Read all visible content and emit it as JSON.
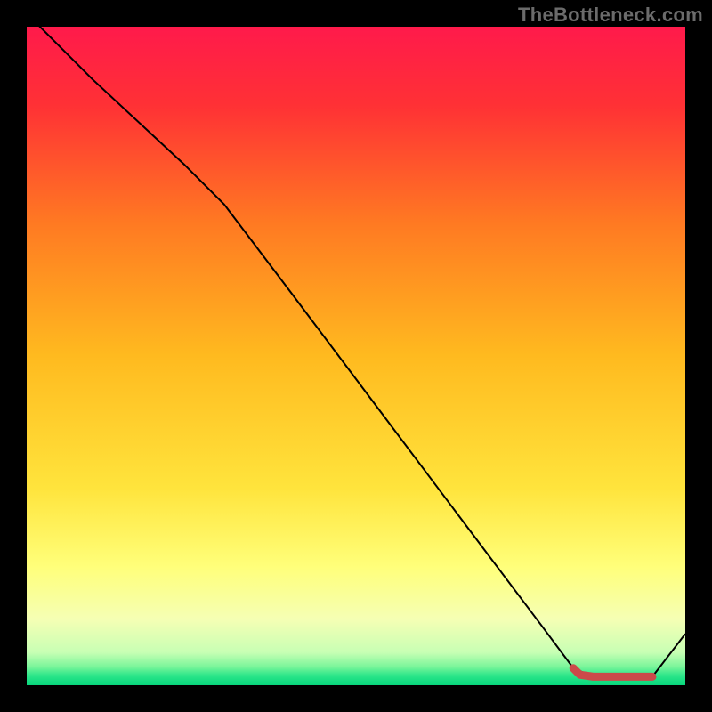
{
  "attribution": "TheBottleneck.com",
  "chart_data": {
    "type": "line",
    "title": "",
    "xlabel": "",
    "ylabel": "",
    "xlim": [
      0,
      100
    ],
    "ylim": [
      0,
      100
    ],
    "background_gradient": {
      "stops": [
        {
          "offset": 0.0,
          "color": "#ff1a4b"
        },
        {
          "offset": 0.12,
          "color": "#ff3135"
        },
        {
          "offset": 0.3,
          "color": "#ff7a22"
        },
        {
          "offset": 0.5,
          "color": "#ffba1f"
        },
        {
          "offset": 0.7,
          "color": "#ffe43c"
        },
        {
          "offset": 0.82,
          "color": "#ffff7a"
        },
        {
          "offset": 0.9,
          "color": "#f5ffb4"
        },
        {
          "offset": 0.95,
          "color": "#c8ffb4"
        },
        {
          "offset": 0.972,
          "color": "#7af59a"
        },
        {
          "offset": 0.985,
          "color": "#2de68a"
        },
        {
          "offset": 1.0,
          "color": "#06d67c"
        }
      ]
    },
    "series": [
      {
        "name": "main-curve",
        "color": "#000000",
        "width": 2,
        "x": [
          0,
          10,
          24,
          30,
          40,
          50,
          60,
          70,
          78,
          83,
          86,
          90,
          95,
          100
        ],
        "y": [
          102,
          92,
          79,
          73,
          59.8,
          46.5,
          33.2,
          19.9,
          9.3,
          2.6,
          1.3,
          1.3,
          1.3,
          7.8
        ]
      },
      {
        "name": "marker-band",
        "color": "#cc4a4a",
        "width": 9,
        "cap": "round",
        "x": [
          83,
          84,
          86,
          88,
          90,
          92,
          94,
          95
        ],
        "y": [
          2.6,
          1.6,
          1.3,
          1.3,
          1.3,
          1.3,
          1.3,
          1.3
        ]
      }
    ]
  }
}
